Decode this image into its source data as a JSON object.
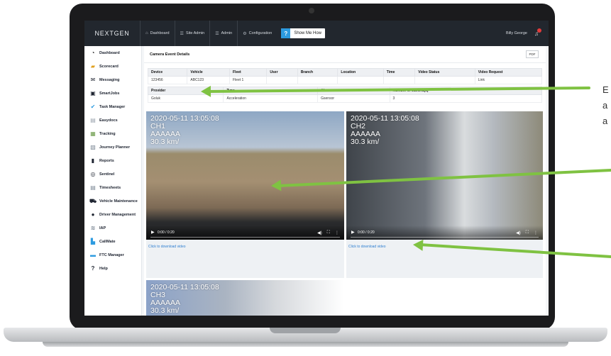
{
  "app": {
    "brand": "NEXTGEN",
    "nav": [
      {
        "icon": "home-icon",
        "glyph": "⌂",
        "label": "Dashboard"
      },
      {
        "icon": "list-icon",
        "glyph": "☰",
        "label": "Site Admin"
      },
      {
        "icon": "list-icon",
        "glyph": "☰",
        "label": "Admin"
      },
      {
        "icon": "gear-icon",
        "glyph": "⚙",
        "label": "Configuration"
      }
    ],
    "help_label": "Show Me How",
    "help_glyph": "?",
    "user_name": "Billy George"
  },
  "sidebar": {
    "items": [
      {
        "label": "Dashboard",
        "icon": "dashboard-icon",
        "glyph": "◔",
        "color": "#222222"
      },
      {
        "label": "Scorecard",
        "icon": "scorecard-icon",
        "glyph": "▰",
        "color": "#e0a020"
      },
      {
        "label": "Messaging",
        "icon": "messaging-icon",
        "glyph": "✉",
        "color": "#1d2330"
      },
      {
        "label": "SmartJobs",
        "icon": "smartjobs-icon",
        "glyph": "▣",
        "color": "#1d2330"
      },
      {
        "label": "Task Manager",
        "icon": "task-manager-icon",
        "glyph": "✔",
        "color": "#2d9be0"
      },
      {
        "label": "Easydocs",
        "icon": "easydocs-icon",
        "glyph": "▤",
        "color": "#9aa3ad"
      },
      {
        "label": "Tracking",
        "icon": "tracking-icon",
        "glyph": "▦",
        "color": "#6a9a48"
      },
      {
        "label": "Journey Planner",
        "icon": "journey-planner-icon",
        "glyph": "▧",
        "color": "#7b8794"
      },
      {
        "label": "Reports",
        "icon": "reports-icon",
        "glyph": "▮",
        "color": "#1d2330"
      },
      {
        "label": "Sentinel",
        "icon": "sentinel-icon",
        "glyph": "◎",
        "color": "#1d2330"
      },
      {
        "label": "Timesheets",
        "icon": "timesheets-icon",
        "glyph": "▤",
        "color": "#7b8794"
      },
      {
        "label": "Vehicle Maintenance",
        "icon": "vehicle-maintenance-icon",
        "glyph": "⛟",
        "color": "#1d2330"
      },
      {
        "label": "Driver Management",
        "icon": "driver-management-icon",
        "glyph": "●",
        "color": "#1d2330"
      },
      {
        "label": "IAP",
        "icon": "iap-icon",
        "glyph": "≋",
        "color": "#7b8794"
      },
      {
        "label": "CallMate",
        "icon": "callmate-icon",
        "glyph": "▙",
        "color": "#2d9be0"
      },
      {
        "label": "FTC Manager",
        "icon": "ftc-manager-icon",
        "glyph": "▬",
        "color": "#2d9be0"
      },
      {
        "label": "Help",
        "icon": "help-icon",
        "glyph": "?",
        "color": "#1d2330"
      }
    ]
  },
  "page": {
    "title": "Camera Event Details",
    "pdf_label": "PDF"
  },
  "event_table": {
    "headers": [
      "Device",
      "Vehicle",
      "Fleet",
      "User",
      "Branch",
      "Location",
      "Time",
      "Video Status",
      "Video Request"
    ],
    "row": [
      "123456",
      "ABC123",
      "Fleet 1",
      "",
      "",
      "",
      "",
      "",
      "Link"
    ]
  },
  "alarm_table": {
    "headers": [
      "Provider",
      "Type",
      "Alarm",
      "Number of camera(s)"
    ],
    "row": [
      "Goluk",
      "Acceleration",
      "Gsensor",
      "3"
    ]
  },
  "videos": [
    {
      "timestamp": "2020-05-11 13:05:08",
      "channel": "CH1",
      "plate": "AAAAAA",
      "speed": "30.3 km/",
      "time": "0:00 / 0:20",
      "download": "Click to download video"
    },
    {
      "timestamp": "2020-05-11 13:05:08",
      "channel": "CH2",
      "plate": "AAAAAA",
      "speed": "30.3 km/",
      "time": "0:00 / 0:20",
      "download": "Click to download video"
    },
    {
      "timestamp": "2020-05-11 13:05:08",
      "channel": "CH3",
      "plate": "AAAAAA",
      "speed": "30.3 km/",
      "time": "",
      "download": ""
    }
  ],
  "callout": {
    "lines": [
      "E",
      "a",
      "a"
    ],
    "arrow_color": "#7fc242"
  }
}
